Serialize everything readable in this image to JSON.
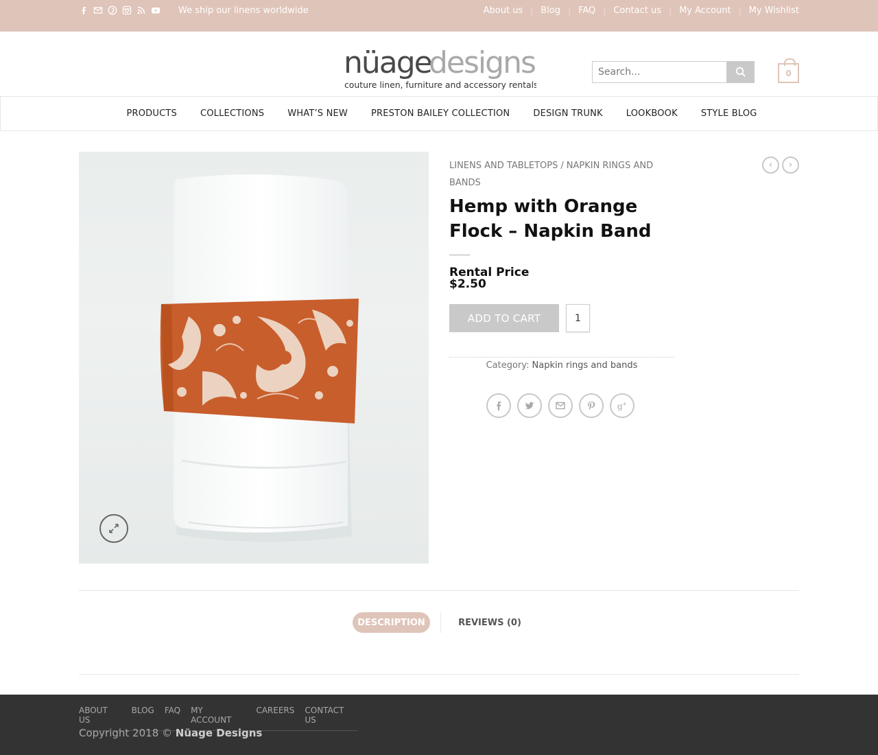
{
  "topbar": {
    "tagline": "We ship our linens worldwide",
    "social_icons": [
      "facebook-icon",
      "email-icon",
      "pinterest-icon",
      "instagram-icon",
      "rss-icon",
      "youtube-icon"
    ],
    "links": [
      "About us",
      "Blog",
      "FAQ",
      "Contact us",
      "My Account",
      "My Wishlist"
    ],
    "bg_color": "#dfc4b9"
  },
  "header": {
    "logo_main_left": "nüage",
    "logo_main_right": "designs",
    "logo_tagline": "couture linen, furniture and accessory rentals",
    "search_placeholder": "Search...",
    "cart_count": "0"
  },
  "nav": {
    "items": [
      "PRODUCTS",
      "COLLECTIONS",
      "WHAT’S NEW",
      "PRESTON BAILEY COLLECTION",
      "DESIGN TRUNK",
      "LOOKBOOK",
      "STYLE BLOG"
    ]
  },
  "product": {
    "breadcrumb": [
      "LINENS AND TABLETOPS",
      "NAPKIN RINGS AND BANDS"
    ],
    "breadcrumb_divider": "/",
    "title": "Hemp with Orange Flock – Napkin Band",
    "price_label": "Rental Price",
    "price": "$2.50",
    "add_to_cart": "ADD TO CART",
    "quantity": "1",
    "category_label": "Category:",
    "category_value": "Napkin rings and bands",
    "share_icons": [
      "facebook-icon",
      "twitter-icon",
      "email-icon",
      "pinterest-icon",
      "google-plus-icon"
    ],
    "nav_icons": [
      "chevron-left-icon",
      "chevron-right-icon"
    ]
  },
  "tabs": {
    "description": "DESCRIPTION",
    "reviews": "REVIEWS (0)"
  },
  "footer": {
    "links": [
      "ABOUT US",
      "BLOG",
      "FAQ",
      "MY ACCOUNT",
      "CAREERS",
      "CONTACT US"
    ],
    "copyright_prefix": "Copyright 2018 ©",
    "copyright_brand": "Nüage Designs"
  }
}
